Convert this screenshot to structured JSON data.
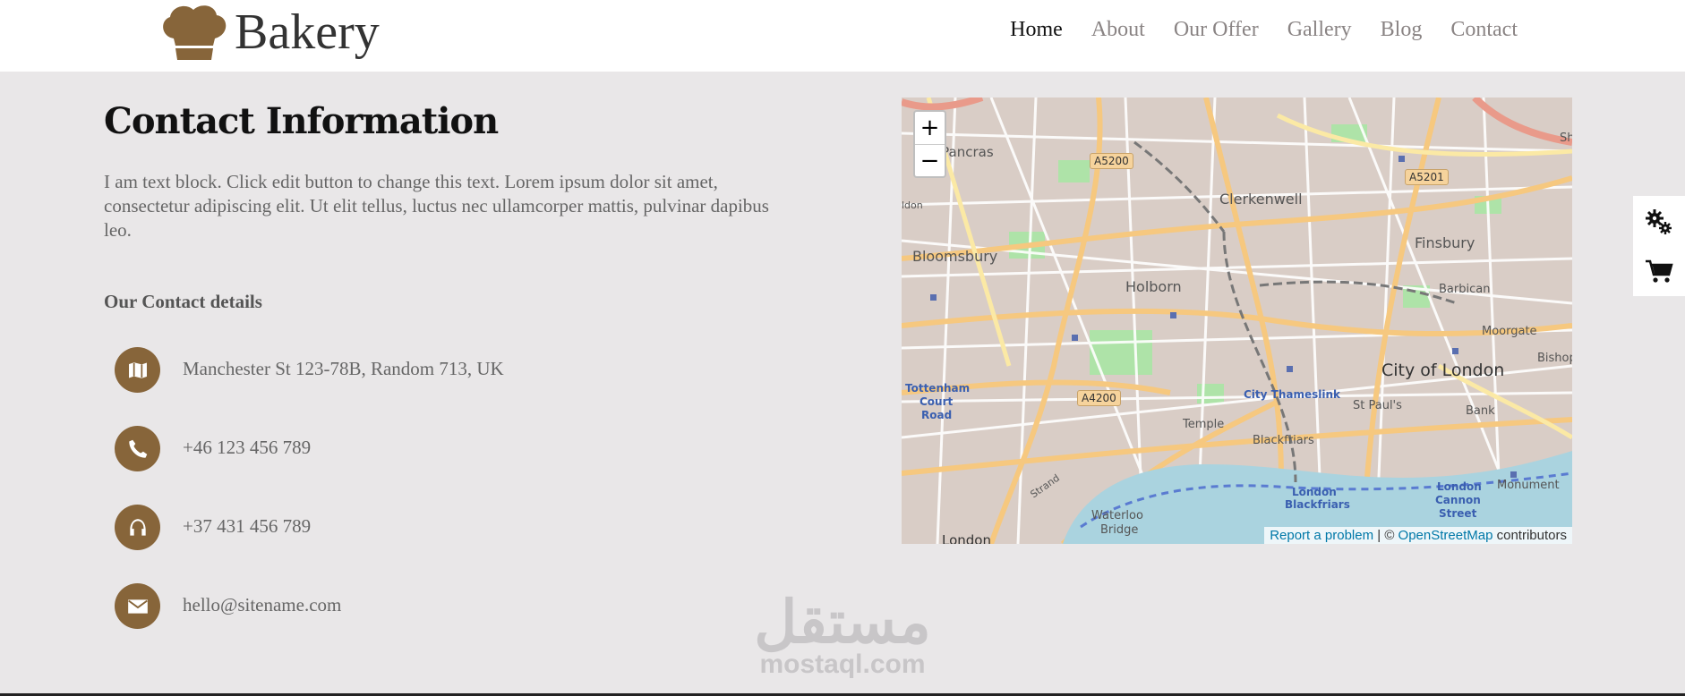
{
  "brand": {
    "name": "Bakery",
    "icon": "chef-hat-icon"
  },
  "nav": {
    "items": [
      {
        "label": "Home",
        "active": true
      },
      {
        "label": "About",
        "active": false
      },
      {
        "label": "Our Offer",
        "active": false
      },
      {
        "label": "Gallery",
        "active": false
      },
      {
        "label": "Blog",
        "active": false
      },
      {
        "label": "Contact",
        "active": false
      }
    ]
  },
  "main": {
    "title": "Contact Information",
    "intro": "I am text block. Click edit button to change this text. Lorem ipsum dolor sit amet, consectetur adipiscing elit. Ut elit tellus, luctus nec ullamcorper mattis, pulvinar dapibus leo.",
    "subtitle": "Our Contact details",
    "contacts": [
      {
        "icon": "map-icon",
        "text": "Manchester St 123-78B, Random 713, UK"
      },
      {
        "icon": "phone-icon",
        "text": "+46 123 456 789"
      },
      {
        "icon": "headphones-icon",
        "text": "+37 431 456 789"
      },
      {
        "icon": "envelope-icon",
        "text": "hello@sitename.com"
      }
    ],
    "accent_color": "#87653a"
  },
  "map": {
    "zoom_in": "+",
    "zoom_out": "−",
    "attribution": {
      "report": "Report a problem",
      "separator": " | © ",
      "osm": "OpenStreetMap",
      "suffix": " contributors"
    },
    "labels": {
      "st_pancras": "St Pancras",
      "clerkenwell": "Clerkenwell",
      "finsbury": "Finsbury",
      "bloomsbury": "Bloomsbury",
      "holborn": "Holborn",
      "barbican": "Barbican",
      "moorgate": "Moorgate",
      "city_of_london": "City of London",
      "tottenham": "Tottenham",
      "court": "Court",
      "road": "Road",
      "city_thameslink": "City Thameslink",
      "st_pauls": "St Paul's",
      "bank": "Bank",
      "temple": "Temple",
      "blackfriars": "Blackfriars",
      "london_blackfriars_1": "London",
      "london_blackfriars_2": "Blackfriars",
      "waterloo": "Waterloo",
      "bridge": "Bridge",
      "london": "London",
      "cannon_1": "London",
      "cannon_2": "Cannon",
      "cannon_3": "Street",
      "monument": "Monument",
      "bishop": "Bishop",
      "strand": "Strand",
      "sh": "Sh",
      "lon": "ldon"
    },
    "roads": {
      "a5200": "A5200",
      "a5201": "A5201",
      "a4200": "A4200"
    }
  },
  "side_panel": {
    "icons": [
      "gears-icon",
      "cart-icon"
    ]
  },
  "watermark": {
    "arabic": "مستقل",
    "latin": "mostaql.com"
  }
}
